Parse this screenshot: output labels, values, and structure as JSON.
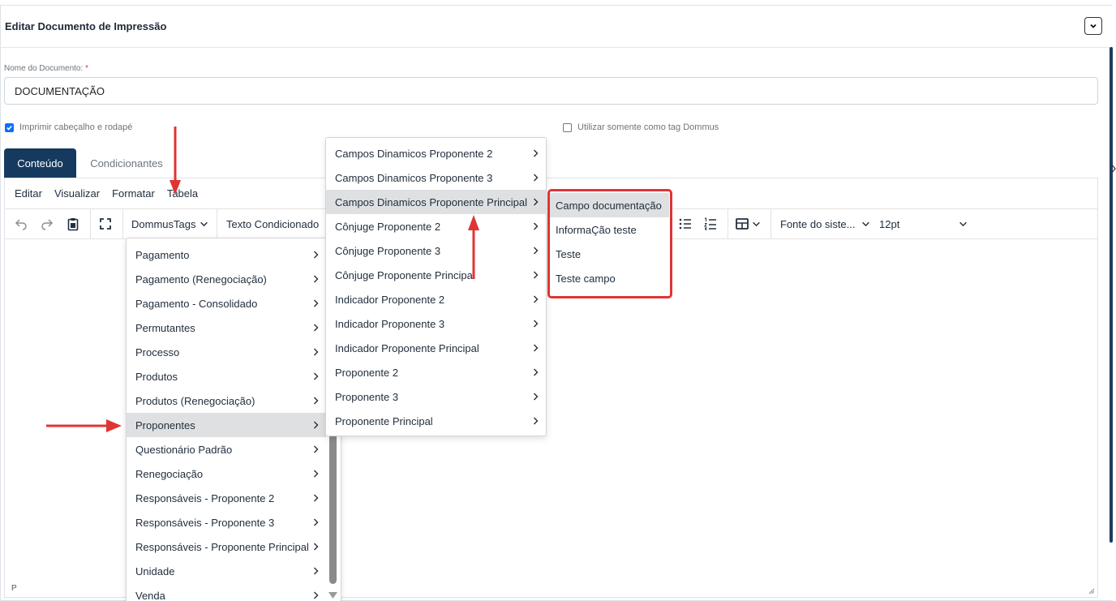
{
  "header": {
    "title": "Editar Documento de Impressão",
    "collapse_icon": "chevron-down-icon"
  },
  "form": {
    "name_label": "Nome do Documento:",
    "required_mark": "*",
    "name_value": "DOCUMENTAÇÃO",
    "print_header_footer_label": "Imprimir cabeçalho e rodapé",
    "print_header_footer_checked": true,
    "only_tag_label": "Utilizar somente como tag Dommus",
    "only_tag_checked": false
  },
  "tabs": [
    {
      "label": "Conteúdo",
      "active": true
    },
    {
      "label": "Condicionantes",
      "active": false
    }
  ],
  "editor": {
    "menubar": [
      "Editar",
      "Visualizar",
      "Formatar",
      "Tabela"
    ],
    "toolbar": {
      "dommus_tags": "DommusTags",
      "texto_condicionado": "Texto Condicionado",
      "font_family": "Fonte do siste...",
      "font_size": "12pt"
    },
    "status_path": "P"
  },
  "menus": {
    "level1": [
      "Pagamento",
      "Pagamento (Renegociação)",
      "Pagamento - Consolidado",
      "Permutantes",
      "Processo",
      "Produtos",
      "Produtos (Renegociação)",
      "Proponentes",
      "Questionário Padrão",
      "Renegociação",
      "Responsáveis - Proponente 2",
      "Responsáveis - Proponente 3",
      "Responsáveis - Proponente Principal",
      "Unidade",
      "Venda"
    ],
    "level1_active": "Proponentes",
    "level2": [
      "Campos Dinamicos Proponente 2",
      "Campos Dinamicos Proponente 3",
      "Campos Dinamicos Proponente Principal",
      "Cônjuge Proponente 2",
      "Cônjuge Proponente 3",
      "Cônjuge Proponente Principal",
      "Indicador Proponente 2",
      "Indicador Proponente 3",
      "Indicador Proponente Principal",
      "Proponente 2",
      "Proponente 3",
      "Proponente Principal"
    ],
    "level2_active": "Campos Dinamicos Proponente Principal",
    "level3": [
      "Campo documentação",
      "InformaÇão teste",
      "Teste",
      "Teste campo"
    ],
    "level3_active": "Campo documentação"
  },
  "colors": {
    "accent": "#163a5f",
    "annotation": "#e03434",
    "checkbox": "#0d6efd"
  }
}
